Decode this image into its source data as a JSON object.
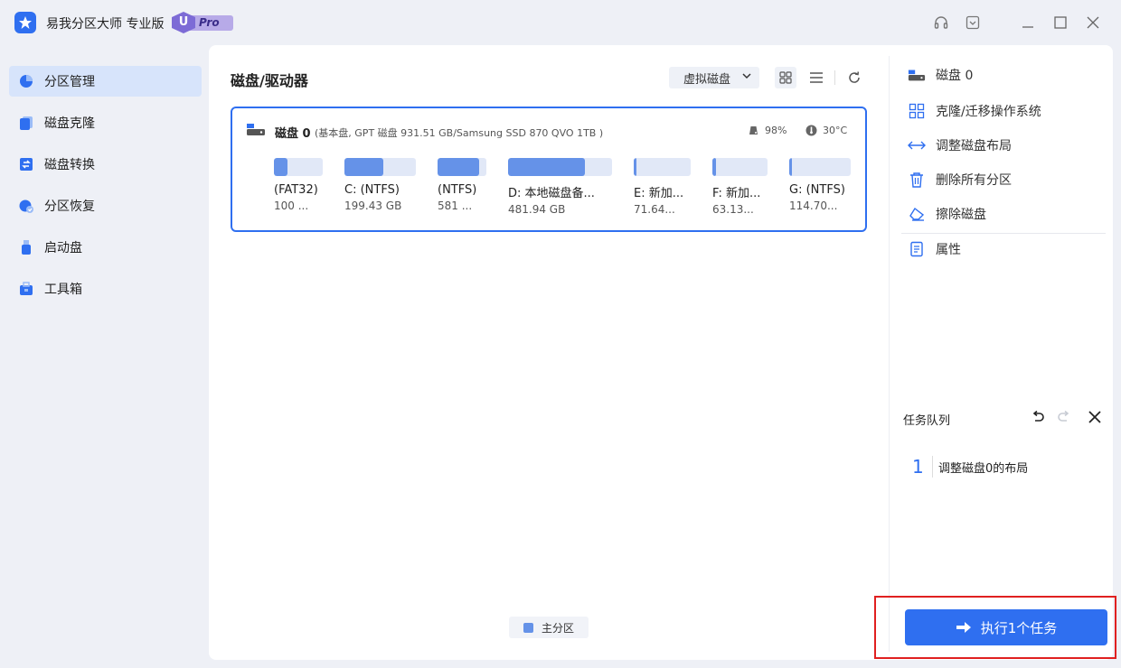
{
  "app": {
    "title": "易我分区大师 专业版",
    "badge_u": "U",
    "badge_pro": "Pro"
  },
  "sidebar": {
    "items": [
      {
        "label": "分区管理",
        "icon": "pie-chart-icon"
      },
      {
        "label": "磁盘克隆",
        "icon": "clone-icon"
      },
      {
        "label": "磁盘转换",
        "icon": "convert-icon"
      },
      {
        "label": "分区恢复",
        "icon": "recovery-icon"
      },
      {
        "label": "启动盘",
        "icon": "usb-icon"
      },
      {
        "label": "工具箱",
        "icon": "toolbox-icon"
      }
    ]
  },
  "main": {
    "title": "磁盘/驱动器",
    "virtual_disk_label": "虚拟磁盘",
    "legend_label": "主分区"
  },
  "disk": {
    "name": "磁盘 0",
    "info": "(基本盘, GPT 磁盘 931.51 GB/Samsung SSD 870 QVO 1TB )",
    "health": "98%",
    "temperature": "30°C",
    "partitions": [
      {
        "name": "(FAT32)",
        "size": "100 ...",
        "used_fraction": 0.28
      },
      {
        "name": "C: (NTFS)",
        "size": "199.43 GB",
        "used_fraction": 0.54
      },
      {
        "name": "(NTFS)",
        "size": "581 ...",
        "used_fraction": 0.85
      },
      {
        "name": "D: 本地磁盘备...",
        "size": "481.94 GB",
        "used_fraction": 0.74
      },
      {
        "name": "E: 新加...",
        "size": "71.64...",
        "used_fraction": 0.05
      },
      {
        "name": "F: 新加...",
        "size": "63.13...",
        "used_fraction": 0.06
      },
      {
        "name": "G: (NTFS)",
        "size": "114.70...",
        "used_fraction": 0.05
      }
    ]
  },
  "right_panel": {
    "disk_label": "磁盘 0",
    "actions": [
      {
        "label": "克隆/迁移操作系统",
        "icon": "clone-os-icon"
      },
      {
        "label": "调整磁盘布局",
        "icon": "resize-layout-icon"
      },
      {
        "label": "删除所有分区",
        "icon": "trash-icon"
      },
      {
        "label": "擦除磁盘",
        "icon": "eraser-icon"
      },
      {
        "label": "属性",
        "icon": "properties-icon"
      }
    ],
    "queue_title": "任务队列",
    "queue_items": [
      {
        "index": "1",
        "text": "调整磁盘0的布局"
      }
    ],
    "execute_label": "执行1个任务"
  },
  "colors": {
    "accent": "#2f6ff0",
    "partition_fill": "#6592e8",
    "partition_bg": "#e1e8f7",
    "highlight": "#e02020"
  }
}
